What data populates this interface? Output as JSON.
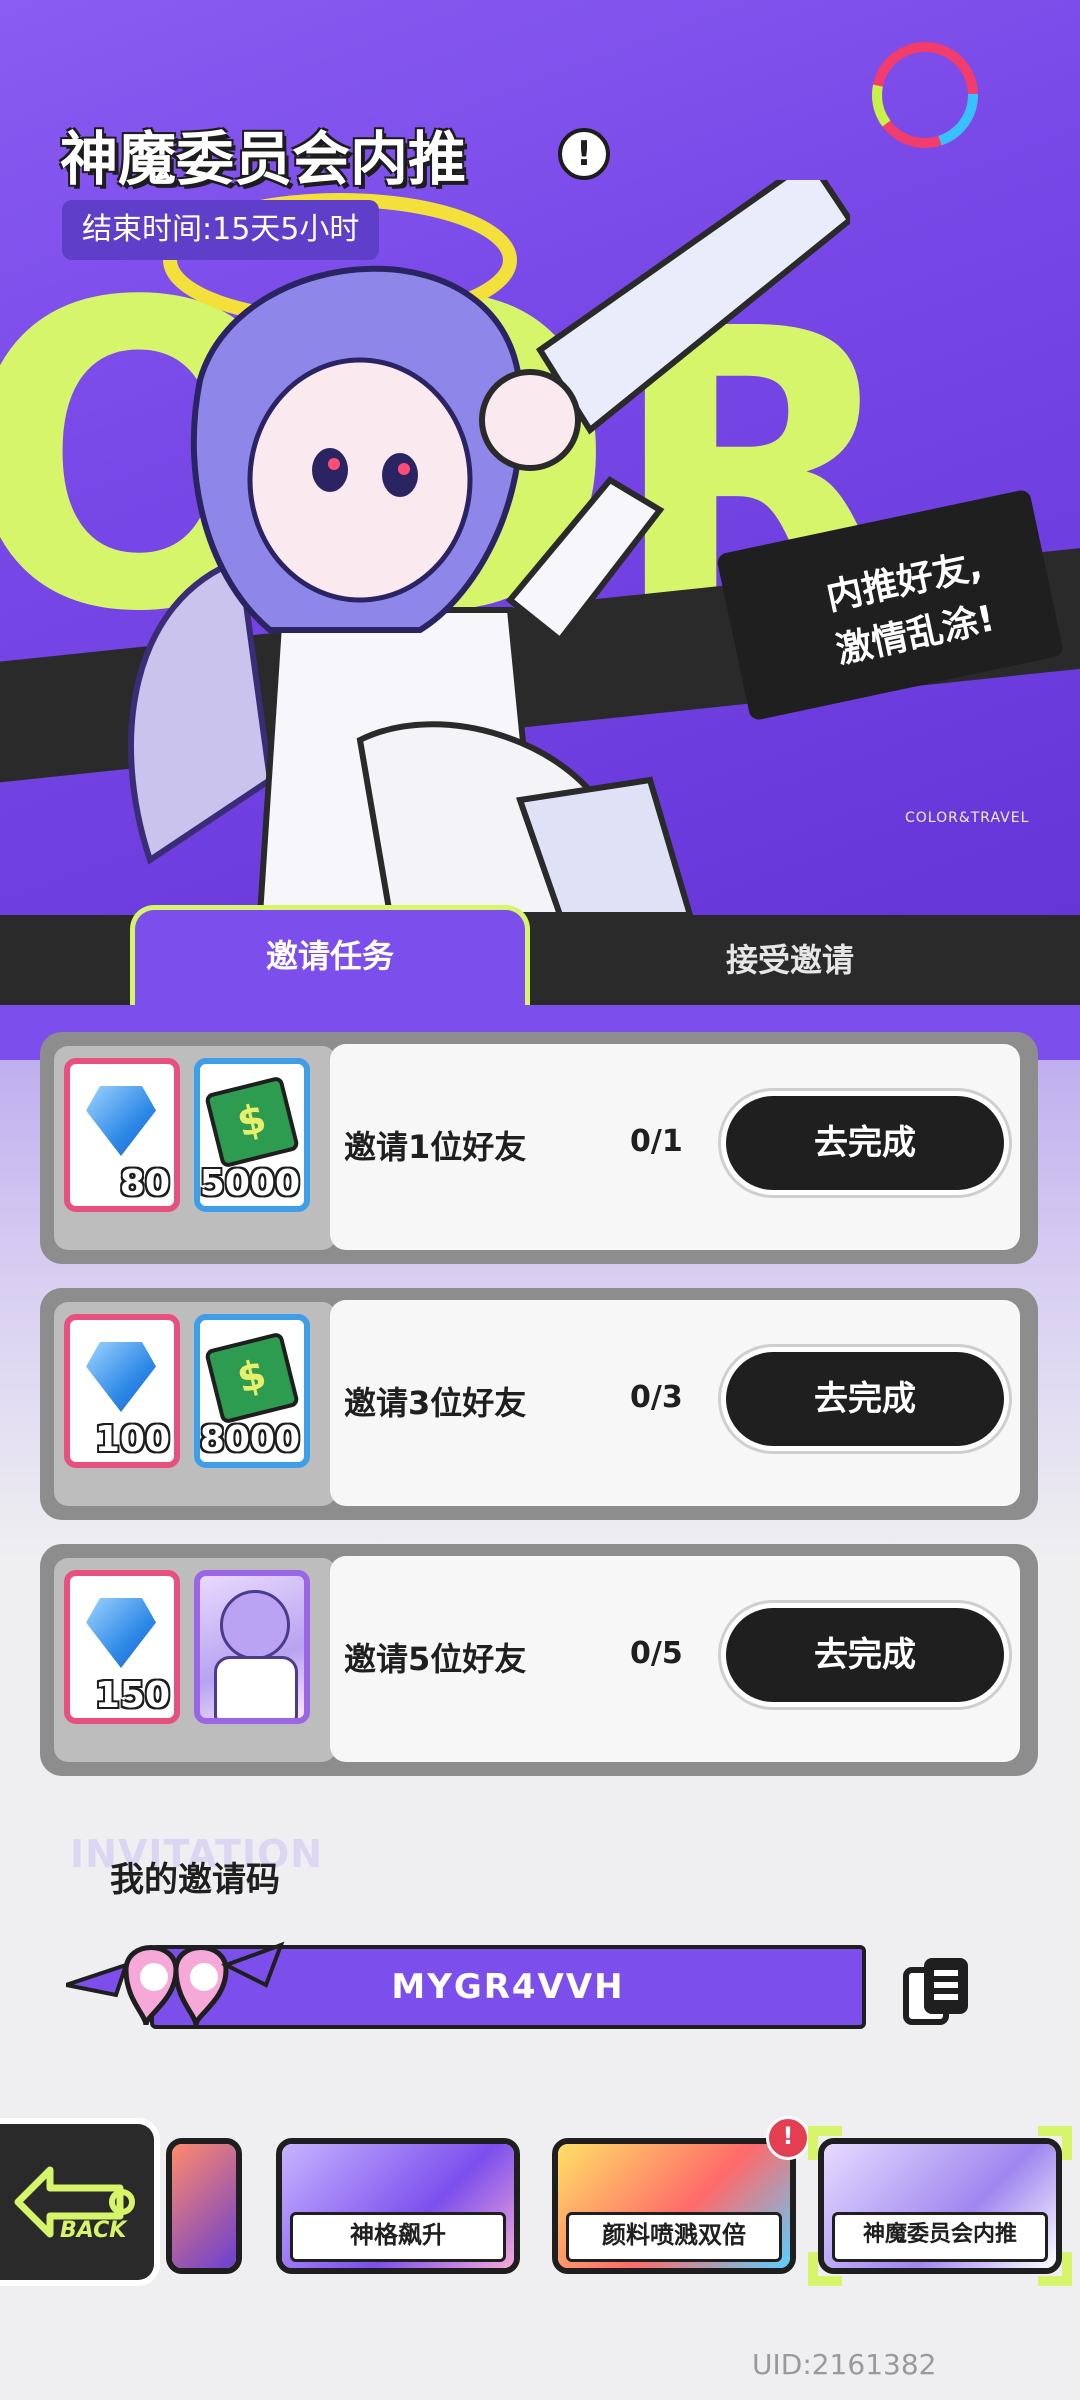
{
  "header": {
    "title": "神魔委员会内推",
    "info_icon": "!",
    "end_time": "结束时间:15天5小时",
    "bubble_line1": "内推好友,",
    "bubble_line2": "激情乱涂!",
    "brand_mark": "COLOR&TRAVEL"
  },
  "tabs": [
    {
      "label": "邀请任务",
      "active": true
    },
    {
      "label": "接受邀请",
      "active": false
    }
  ],
  "tasks": [
    {
      "rewards": [
        {
          "icon": "gem-icon",
          "qty": "80"
        },
        {
          "icon": "cash-icon",
          "qty": "5000"
        }
      ],
      "label": "邀请1位好友",
      "progress": "0/1",
      "button": "去完成"
    },
    {
      "rewards": [
        {
          "icon": "gem-icon",
          "qty": "100"
        },
        {
          "icon": "cash-icon",
          "qty": "8000"
        }
      ],
      "label": "邀请3位好友",
      "progress": "0/3",
      "button": "去完成"
    },
    {
      "rewards": [
        {
          "icon": "gem-icon",
          "qty": "150"
        },
        {
          "icon": "character-avatar-icon",
          "qty": ""
        }
      ],
      "label": "邀请5位好友",
      "progress": "0/5",
      "button": "去完成"
    }
  ],
  "invitation": {
    "bg_text": "INVITATION",
    "title": "我的邀请码",
    "code": "MYGR4VVH",
    "copy_icon": "copy-icon"
  },
  "bottom_nav": {
    "back_label": "BACK",
    "items": [
      {
        "label": "神格飙升"
      },
      {
        "label": "颜料喷溅双倍",
        "badge": "!"
      },
      {
        "label": "神魔委员会内推",
        "selected": true
      }
    ]
  },
  "uid": "UID:2161382",
  "colors": {
    "accent_purple": "#7c4fed",
    "accent_lime": "#d6f56b",
    "gem_border": "#e8507f",
    "cash_border": "#3e9ee8",
    "dark": "#1f1f1f"
  }
}
